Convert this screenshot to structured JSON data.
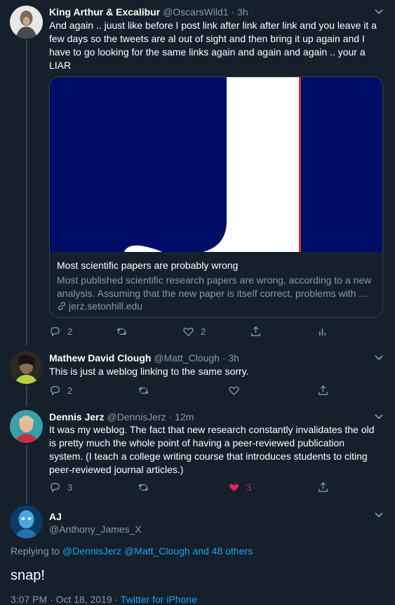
{
  "colors": {
    "background": "#15202b",
    "secondary_text": "#8899a6",
    "link": "#1da1f2",
    "like_active": "#e0245e",
    "card_image": "#000d66"
  },
  "tweets": [
    {
      "name": "King Arthur & Excalibur",
      "handle": "@OscarsWild1",
      "time": "· 3h",
      "text": "And again .. juust like before I post link after link after link and you leave it a few days so the tweets are al out of sight and then bring it up again and I have to go looking for the same links again and again and again .. your a LIAR",
      "card": {
        "title": "Most scientific papers are probably wrong",
        "description": "Most published scientific research papers are wrong, according to a new analysis. Assuming that the new paper is itself correct, problems with ...",
        "domain": "jerz.setonhill.edu"
      },
      "actions": {
        "replies": "2",
        "retweets": "",
        "likes": "2"
      }
    },
    {
      "name": "Mathew David Clough",
      "handle": "@Matt_Clough",
      "time": "· 3h",
      "text": "This is just a weblog linking to the same sorry.",
      "actions": {
        "replies": "2",
        "retweets": "",
        "likes": ""
      }
    },
    {
      "name": "Dennis Jerz",
      "handle": "@DennisJerz",
      "time": "· 12m",
      "text": "It was my weblog. The fact that new research constantly invalidates the old is pretty much the whole point of having a peer-reviewed publication system. (I teach a college writing course that introduces students to citing peer-reviewed journal articles.)",
      "actions": {
        "replies": "3",
        "retweets": "",
        "likes": "3"
      }
    }
  ],
  "main_tweet": {
    "name": "AJ",
    "handle": "@Anthony_James_X",
    "replying_prefix": "Replying to",
    "replying_links": "@DennisJerz @Matt_Clough and 48 others",
    "text": "snap!",
    "timestamp": "3:07 PM · Oct 18, 2019 ·",
    "source": "Twitter for iPhone"
  },
  "icons": [
    "reply-icon",
    "retweet-icon",
    "like-icon",
    "share-icon",
    "analytics-icon",
    "caret-down-icon",
    "link-icon"
  ]
}
